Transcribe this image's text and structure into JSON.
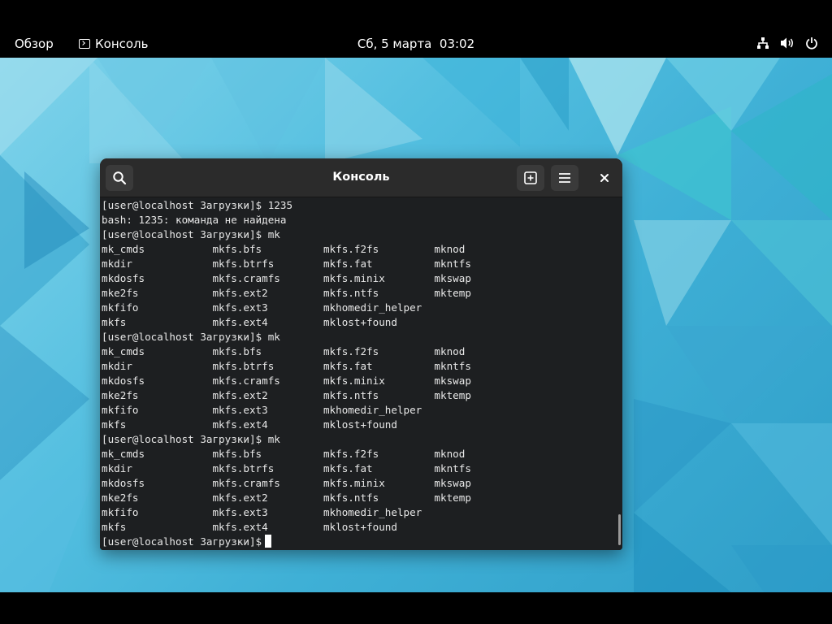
{
  "topbar": {
    "activities": "Обзор",
    "app_name": "Консоль",
    "clock": "Сб, 5 марта  03:02",
    "icons": [
      "network-icon",
      "volume-icon",
      "power-icon"
    ]
  },
  "window": {
    "title": "Консоль",
    "buttons": [
      "search-icon",
      "new-tab-icon",
      "hamburger-menu-icon",
      "close-icon"
    ]
  },
  "terminal": {
    "lines": [
      "[user@localhost Загрузки]$ 1235",
      "bash: 1235: команда не найдена",
      "[user@localhost Загрузки]$ mk",
      "mk_cmds           mkfs.bfs          mkfs.f2fs         mknod",
      "mkdir             mkfs.btrfs        mkfs.fat          mkntfs",
      "mkdosfs           mkfs.cramfs       mkfs.minix        mkswap",
      "mke2fs            mkfs.ext2         mkfs.ntfs         mktemp",
      "mkfifo            mkfs.ext3         mkhomedir_helper",
      "mkfs              mkfs.ext4         mklost+found",
      "[user@localhost Загрузки]$ mk",
      "mk_cmds           mkfs.bfs          mkfs.f2fs         mknod",
      "mkdir             mkfs.btrfs        mkfs.fat          mkntfs",
      "mkdosfs           mkfs.cramfs       mkfs.minix        mkswap",
      "mke2fs            mkfs.ext2         mkfs.ntfs         mktemp",
      "mkfifo            mkfs.ext3         mkhomedir_helper",
      "mkfs              mkfs.ext4         mklost+found",
      "[user@localhost Загрузки]$ mk",
      "mk_cmds           mkfs.bfs          mkfs.f2fs         mknod",
      "mkdir             mkfs.btrfs        mkfs.fat          mkntfs",
      "mkdosfs           mkfs.cramfs       mkfs.minix        mkswap",
      "mke2fs            mkfs.ext2         mkfs.ntfs         mktemp",
      "mkfifo            mkfs.ext3         mkhomedir_helper",
      "mkfs              mkfs.ext4         mklost+found"
    ],
    "prompt": "[user@localhost Загрузки]$"
  },
  "colors": {
    "terminal_bg": "#1d1f21",
    "headerbar_bg": "#2b2b2b",
    "desktop_accent": "#3fb0d6"
  }
}
